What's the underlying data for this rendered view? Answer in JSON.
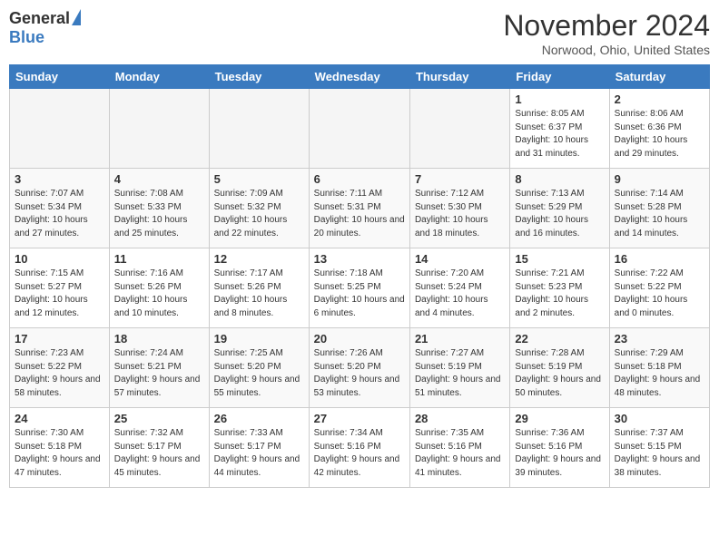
{
  "logo": {
    "general": "General",
    "blue": "Blue"
  },
  "header": {
    "month": "November 2024",
    "location": "Norwood, Ohio, United States"
  },
  "days_of_week": [
    "Sunday",
    "Monday",
    "Tuesday",
    "Wednesday",
    "Thursday",
    "Friday",
    "Saturday"
  ],
  "weeks": [
    [
      {
        "day": "",
        "empty": true
      },
      {
        "day": "",
        "empty": true
      },
      {
        "day": "",
        "empty": true
      },
      {
        "day": "",
        "empty": true
      },
      {
        "day": "",
        "empty": true
      },
      {
        "day": "1",
        "sunrise": "8:05 AM",
        "sunset": "6:37 PM",
        "daylight": "10 hours and 31 minutes."
      },
      {
        "day": "2",
        "sunrise": "8:06 AM",
        "sunset": "6:36 PM",
        "daylight": "10 hours and 29 minutes."
      }
    ],
    [
      {
        "day": "3",
        "sunrise": "7:07 AM",
        "sunset": "5:34 PM",
        "daylight": "10 hours and 27 minutes."
      },
      {
        "day": "4",
        "sunrise": "7:08 AM",
        "sunset": "5:33 PM",
        "daylight": "10 hours and 25 minutes."
      },
      {
        "day": "5",
        "sunrise": "7:09 AM",
        "sunset": "5:32 PM",
        "daylight": "10 hours and 22 minutes."
      },
      {
        "day": "6",
        "sunrise": "7:11 AM",
        "sunset": "5:31 PM",
        "daylight": "10 hours and 20 minutes."
      },
      {
        "day": "7",
        "sunrise": "7:12 AM",
        "sunset": "5:30 PM",
        "daylight": "10 hours and 18 minutes."
      },
      {
        "day": "8",
        "sunrise": "7:13 AM",
        "sunset": "5:29 PM",
        "daylight": "10 hours and 16 minutes."
      },
      {
        "day": "9",
        "sunrise": "7:14 AM",
        "sunset": "5:28 PM",
        "daylight": "10 hours and 14 minutes."
      }
    ],
    [
      {
        "day": "10",
        "sunrise": "7:15 AM",
        "sunset": "5:27 PM",
        "daylight": "10 hours and 12 minutes."
      },
      {
        "day": "11",
        "sunrise": "7:16 AM",
        "sunset": "5:26 PM",
        "daylight": "10 hours and 10 minutes."
      },
      {
        "day": "12",
        "sunrise": "7:17 AM",
        "sunset": "5:26 PM",
        "daylight": "10 hours and 8 minutes."
      },
      {
        "day": "13",
        "sunrise": "7:18 AM",
        "sunset": "5:25 PM",
        "daylight": "10 hours and 6 minutes."
      },
      {
        "day": "14",
        "sunrise": "7:20 AM",
        "sunset": "5:24 PM",
        "daylight": "10 hours and 4 minutes."
      },
      {
        "day": "15",
        "sunrise": "7:21 AM",
        "sunset": "5:23 PM",
        "daylight": "10 hours and 2 minutes."
      },
      {
        "day": "16",
        "sunrise": "7:22 AM",
        "sunset": "5:22 PM",
        "daylight": "10 hours and 0 minutes."
      }
    ],
    [
      {
        "day": "17",
        "sunrise": "7:23 AM",
        "sunset": "5:22 PM",
        "daylight": "9 hours and 58 minutes."
      },
      {
        "day": "18",
        "sunrise": "7:24 AM",
        "sunset": "5:21 PM",
        "daylight": "9 hours and 57 minutes."
      },
      {
        "day": "19",
        "sunrise": "7:25 AM",
        "sunset": "5:20 PM",
        "daylight": "9 hours and 55 minutes."
      },
      {
        "day": "20",
        "sunrise": "7:26 AM",
        "sunset": "5:20 PM",
        "daylight": "9 hours and 53 minutes."
      },
      {
        "day": "21",
        "sunrise": "7:27 AM",
        "sunset": "5:19 PM",
        "daylight": "9 hours and 51 minutes."
      },
      {
        "day": "22",
        "sunrise": "7:28 AM",
        "sunset": "5:19 PM",
        "daylight": "9 hours and 50 minutes."
      },
      {
        "day": "23",
        "sunrise": "7:29 AM",
        "sunset": "5:18 PM",
        "daylight": "9 hours and 48 minutes."
      }
    ],
    [
      {
        "day": "24",
        "sunrise": "7:30 AM",
        "sunset": "5:18 PM",
        "daylight": "9 hours and 47 minutes."
      },
      {
        "day": "25",
        "sunrise": "7:32 AM",
        "sunset": "5:17 PM",
        "daylight": "9 hours and 45 minutes."
      },
      {
        "day": "26",
        "sunrise": "7:33 AM",
        "sunset": "5:17 PM",
        "daylight": "9 hours and 44 minutes."
      },
      {
        "day": "27",
        "sunrise": "7:34 AM",
        "sunset": "5:16 PM",
        "daylight": "9 hours and 42 minutes."
      },
      {
        "day": "28",
        "sunrise": "7:35 AM",
        "sunset": "5:16 PM",
        "daylight": "9 hours and 41 minutes."
      },
      {
        "day": "29",
        "sunrise": "7:36 AM",
        "sunset": "5:16 PM",
        "daylight": "9 hours and 39 minutes."
      },
      {
        "day": "30",
        "sunrise": "7:37 AM",
        "sunset": "5:15 PM",
        "daylight": "9 hours and 38 minutes."
      }
    ]
  ]
}
